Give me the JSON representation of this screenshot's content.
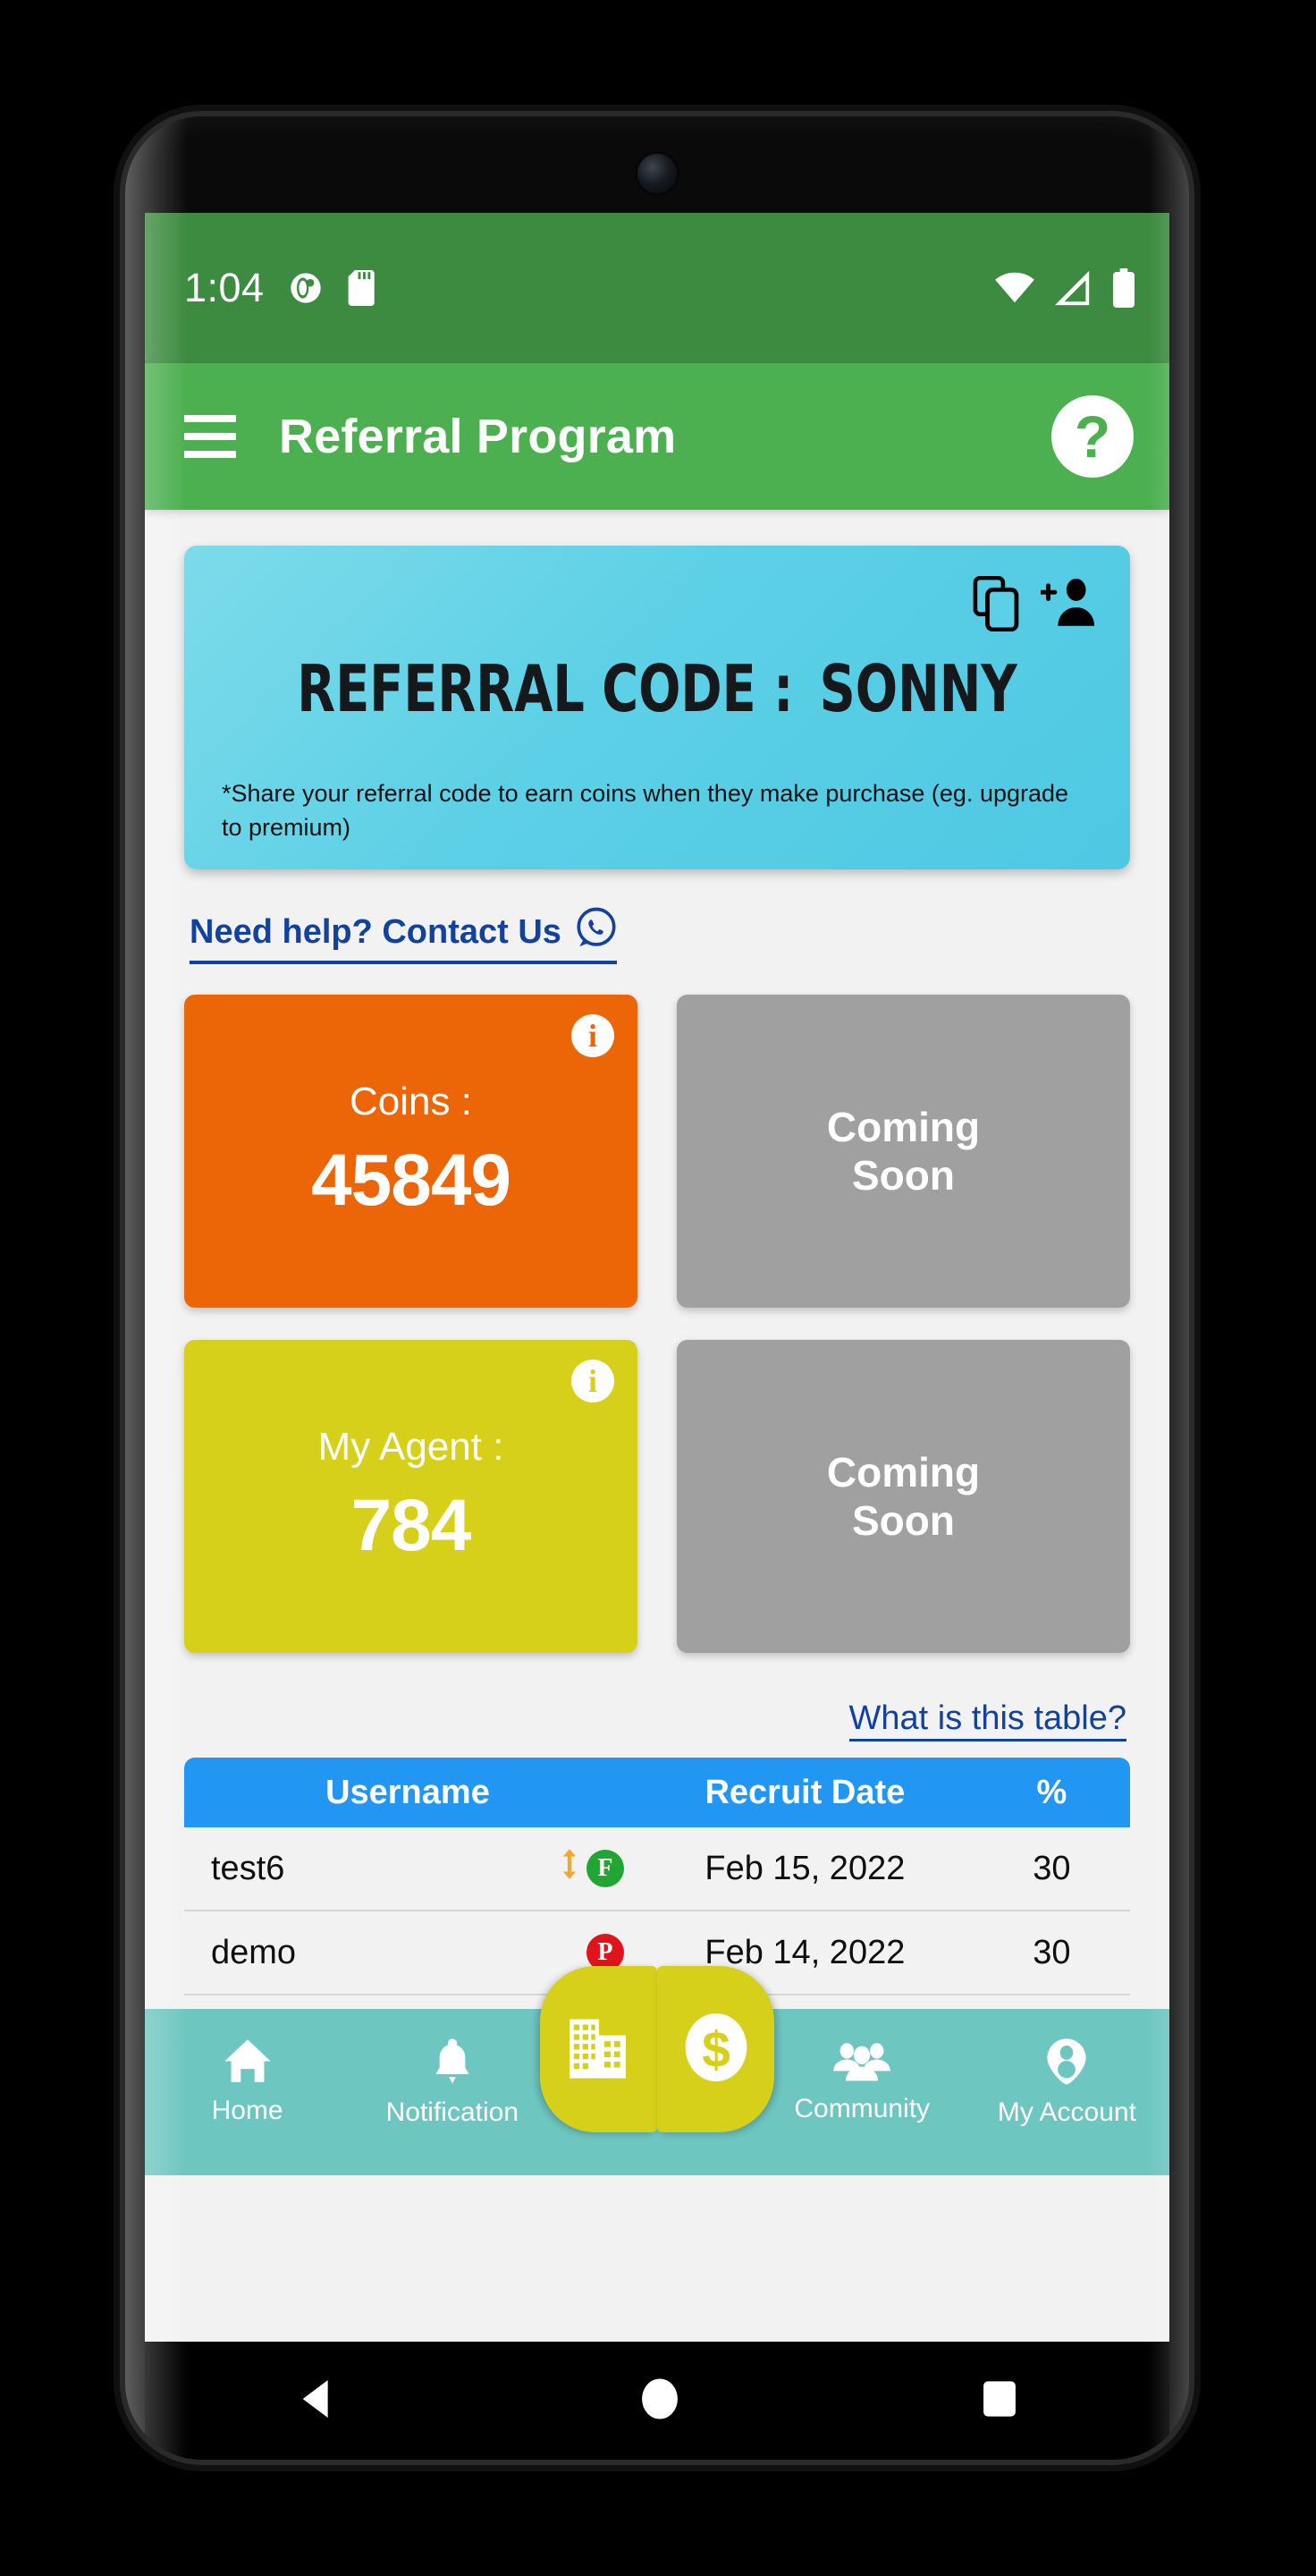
{
  "status_bar": {
    "clock": "1:04",
    "left_icons": [
      "notification-dot-icon",
      "sd-card-icon"
    ],
    "right_icons": [
      "wifi-icon",
      "cellular-signal-icon",
      "battery-icon"
    ],
    "background_color": "#3d8b40"
  },
  "app_bar": {
    "menu_icon": "hamburger-menu-icon",
    "title": "Referral Program",
    "help_label": "?",
    "background_color": "#4caf50"
  },
  "referral_card": {
    "label": "REFERRAL CODE :",
    "code": "SONNY",
    "note": "*Share your referral code to earn coins when they make purchase (eg. upgrade to premium)",
    "copy_icon": "copy-icon",
    "add_person_icon": "add-person-icon",
    "background_color": "#5cd0e6"
  },
  "contact": {
    "label": "Need help? Contact Us",
    "icon": "whatsapp-icon",
    "color": "#12429d"
  },
  "stats": [
    {
      "label": "Coins :",
      "value": "45849",
      "style": "orange",
      "info_icon": "info-icon",
      "color": "#ec6608"
    },
    {
      "soon_line1": "Coming",
      "soon_line2": "Soon",
      "style": "grey",
      "color": "#a0a0a0"
    },
    {
      "label": "My Agent :",
      "value": "784",
      "style": "yellow",
      "info_icon": "info-icon",
      "color": "#d6d01a"
    },
    {
      "soon_line1": "Coming",
      "soon_line2": "Soon",
      "style": "grey",
      "color": "#a0a0a0"
    }
  ],
  "table": {
    "help_link": "What is this table?",
    "header_color": "#2196f3",
    "columns": [
      "Username",
      "Recruit Date",
      "%"
    ],
    "rows": [
      {
        "username": "test6",
        "badge_arrow": "upgrade-arrow-icon",
        "badge_letter": "F",
        "badge_color": "#22a532",
        "recruit_date": "Feb 15, 2022",
        "percent": "30"
      },
      {
        "username": "demo",
        "badge_arrow": "",
        "badge_letter": "P",
        "badge_color": "#e0151b",
        "recruit_date": "Feb 14, 2022",
        "percent": "30"
      }
    ]
  },
  "bottom_nav": {
    "background_color": "#6ec6c1",
    "items": [
      {
        "label": "Home",
        "icon": "home-icon"
      },
      {
        "label": "Notification",
        "icon": "bell-icon"
      },
      {
        "label": "Community",
        "icon": "people-group-icon"
      },
      {
        "label": "My Account",
        "icon": "account-person-icon"
      }
    ],
    "fab_left_icon": "building-icon",
    "fab_right_icon": "dollar-coin-icon",
    "fab_color": "#d6d01a"
  },
  "android_nav": {
    "back_icon": "triangle-back-icon",
    "home_icon": "circle-home-icon",
    "recents_icon": "square-recents-icon"
  }
}
